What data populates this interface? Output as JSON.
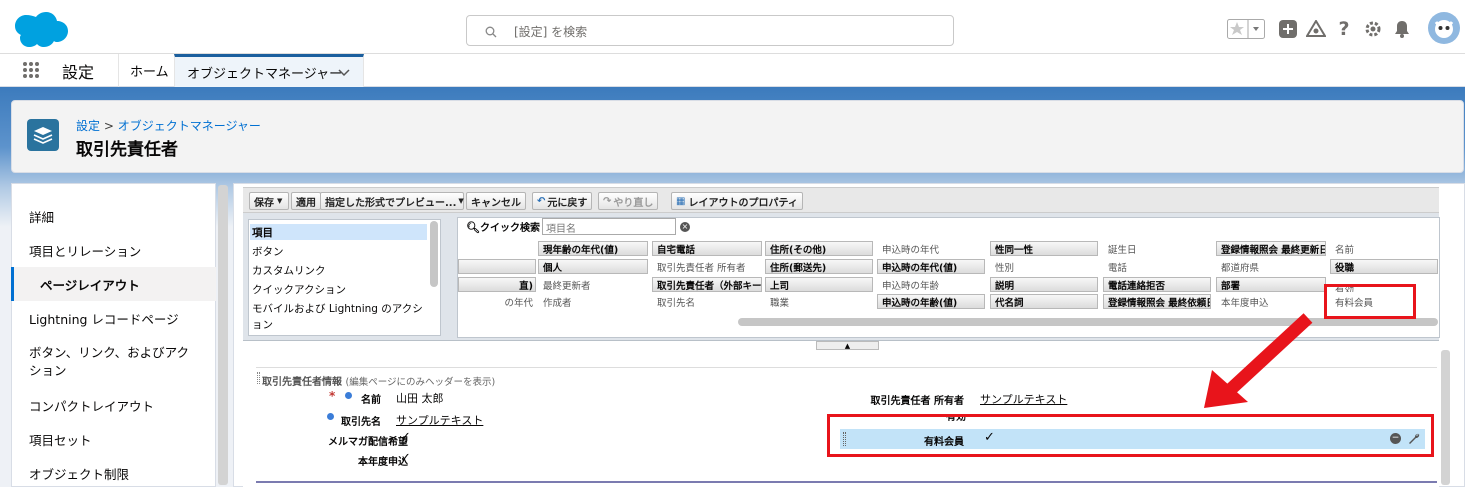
{
  "header": {
    "search_placeholder": "[設定] を検索"
  },
  "nav": {
    "app_name": "設定",
    "home_tab": "ホーム",
    "object_manager_tab": "オブジェクトマネージャー"
  },
  "page_header": {
    "breadcrumb_root": "設定",
    "breadcrumb_sep": " > ",
    "breadcrumb_child": "オブジェクトマネージャー",
    "title": "取引先責任者"
  },
  "left_nav": [
    "詳細",
    "項目とリレーション",
    "ページレイアウト",
    "Lightning レコードページ",
    "ボタン、リンク、およびアク",
    "ション",
    "コンパクトレイアウト",
    "項目セット",
    "オブジェクト制限"
  ],
  "left_nav_selected": "ページレイアウト",
  "toolbar": {
    "save": "保存",
    "apply": "適用",
    "preview": "指定した形式でプレビュー...",
    "cancel": "キャンセル",
    "undo": "元に戻す",
    "redo": "やり直し",
    "layout_props": "レイアウトのプロパティ"
  },
  "palette": {
    "categories": [
      "項目",
      "ボタン",
      "カスタムリンク",
      "クイックアクション",
      "モバイルおよび Lightning のアクシ",
      "ョン"
    ],
    "quick_find_label": "クイック検索",
    "quick_find_placeholder": "項目名",
    "rows": [
      [
        "",
        "現年齢の年代(値)",
        "自宅電話",
        "住所(その他)",
        "申込時の年代",
        "性同一性",
        "誕生日",
        "登録情報照会 最終更新日",
        "名前"
      ],
      [
        "",
        "個人",
        "取引先責任者 所有者",
        "住所(郵送先)",
        "申込時の年代(値)",
        "性別",
        "電話",
        "都道府県",
        "役職"
      ],
      [
        "直)",
        "最終更新者",
        "取引先責任者（外部キー）",
        "上司",
        "申込時の年齢",
        "説明",
        "電話連絡拒否",
        "部署",
        "有効"
      ],
      [
        "の年代",
        "作成者",
        "取引先名",
        "職業",
        "申込時の年齢(値)",
        "代名詞",
        "登録情報照会 最終依頼日",
        "本年度申込",
        "有料会員"
      ]
    ],
    "available": [
      [
        false,
        true,
        true,
        true,
        false,
        true,
        false,
        true,
        false
      ],
      [
        true,
        true,
        false,
        true,
        true,
        false,
        false,
        false,
        true
      ],
      [
        true,
        false,
        true,
        true,
        false,
        true,
        true,
        true,
        false
      ],
      [
        false,
        false,
        false,
        false,
        true,
        true,
        true,
        false,
        false
      ]
    ]
  },
  "section": {
    "title": "取引先責任者情報",
    "subtitle": "(編集ページにのみヘッダーを表示)"
  },
  "fields_left": [
    {
      "label": "名前",
      "value": "山田 太郎"
    },
    {
      "label": "取引先名",
      "value": "サンプルテキスト"
    },
    {
      "label": "メルマガ配信希望",
      "value": "✓"
    },
    {
      "label": "本年度申込",
      "value": "✓"
    }
  ],
  "fields_right": [
    {
      "label": "取引先責任者 所有者",
      "value": "サンプルテキスト"
    },
    {
      "label": "有効",
      "value": "✓"
    },
    {
      "label": "有料会員",
      "value": "✓"
    }
  ],
  "colors": {
    "accent": "#0070d2",
    "highlight": "#e8141b",
    "row_highlight": "#c2e3f8"
  }
}
